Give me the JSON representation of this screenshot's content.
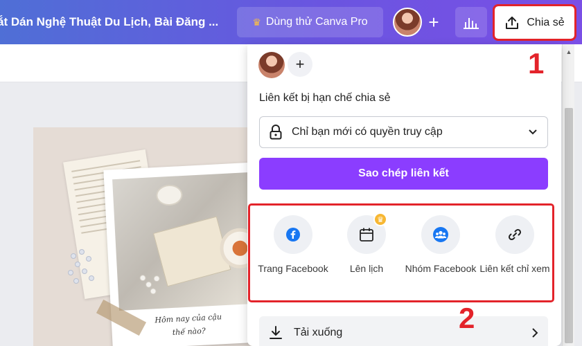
{
  "header": {
    "design_title": "ắt Dán Nghệ Thuật Du Lịch, Bài Đăng ...",
    "try_pro_label": "Dùng thử Canva Pro",
    "share_label": "Chia sẻ"
  },
  "icons": {
    "crown": "crown-icon",
    "upload": "upload-icon",
    "stats": "bar-chart-icon",
    "lock": "lock-icon",
    "chevron": "chevron-down-icon"
  },
  "design": {
    "caption_line1": "Hôm nay của cậu",
    "caption_line2": "thế nào?"
  },
  "share_panel": {
    "access_label": "Liên kết bị hạn chế chia sẻ",
    "access_value": "Chỉ bạn mới có quyền truy cập",
    "copy_link_label": "Sao chép liên kết",
    "options": [
      {
        "icon": "facebook-icon",
        "label": "Trang Facebook"
      },
      {
        "icon": "calendar-icon",
        "label": "Lên lịch"
      },
      {
        "icon": "group-icon",
        "label": "Nhóm Facebook"
      },
      {
        "icon": "link-icon",
        "label": "Liên kết chỉ xem"
      }
    ],
    "download_label": "Tải xuống"
  },
  "annotations": {
    "marker_1": "1",
    "marker_2": "2"
  },
  "colors": {
    "brand_purple": "#8b3dff",
    "highlight_red": "#e3232a",
    "facebook_blue": "#1877f2"
  }
}
